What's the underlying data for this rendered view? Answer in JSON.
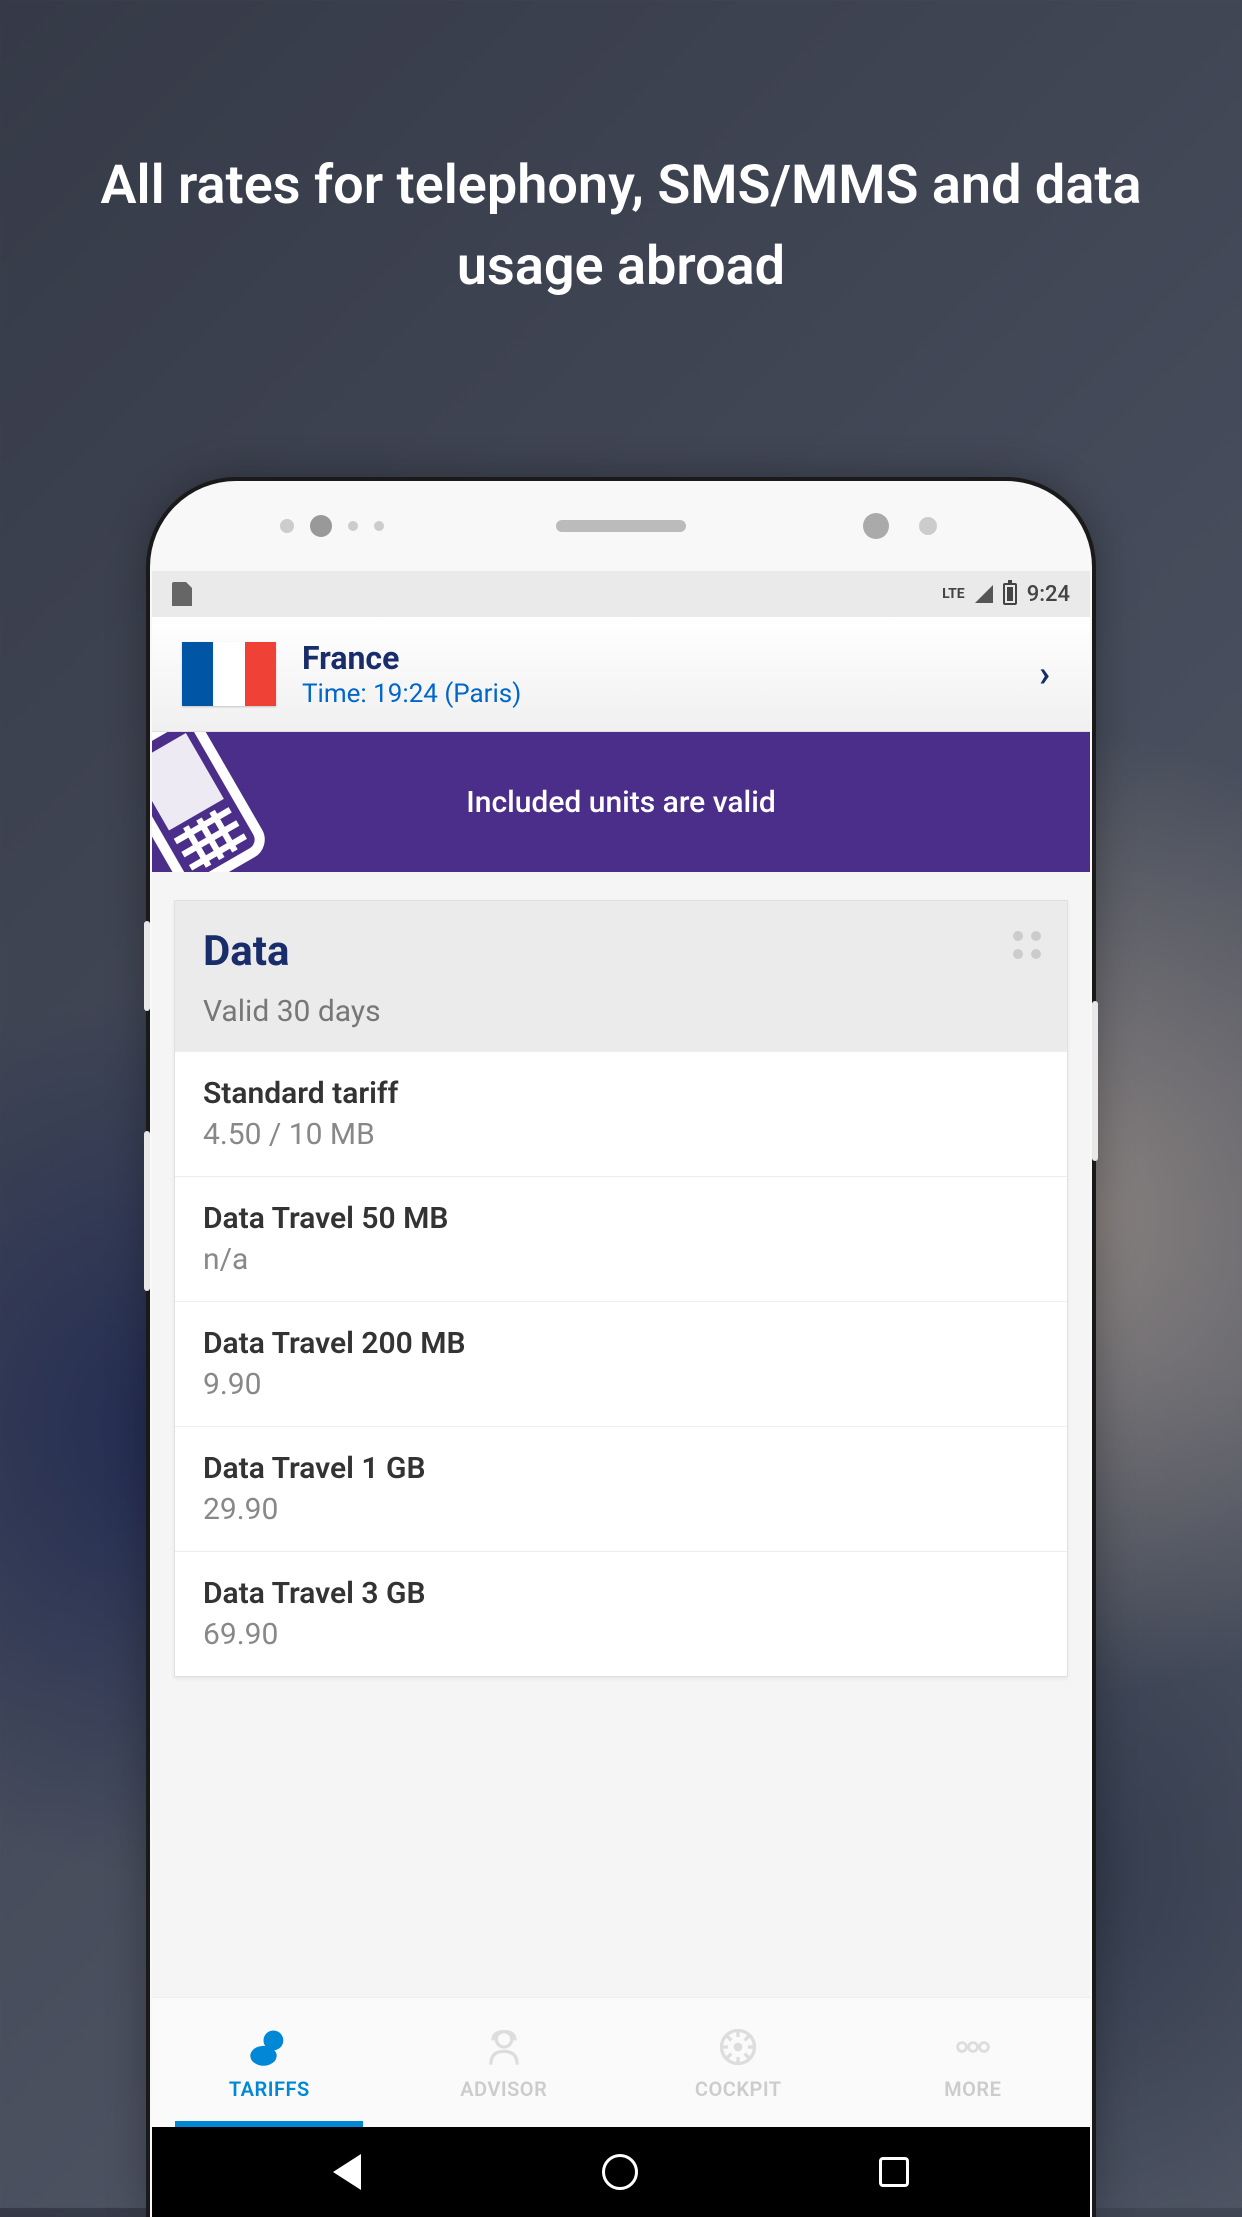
{
  "headline": "All rates for telephony, SMS/MMS and data usage abroad",
  "statusbar": {
    "network": "LTE",
    "time": "9:24"
  },
  "country": {
    "name": "France",
    "time_label": "Time: 19:24 (Paris)"
  },
  "banner": {
    "text": "Included units are valid"
  },
  "card": {
    "title": "Data",
    "subtitle": "Valid 30 days",
    "tariffs": [
      {
        "name": "Standard tariff",
        "price": "4.50 / 10 MB"
      },
      {
        "name": "Data Travel 50 MB",
        "price": "n/a"
      },
      {
        "name": "Data Travel 200 MB",
        "price": "9.90"
      },
      {
        "name": "Data Travel 1 GB",
        "price": "29.90"
      },
      {
        "name": "Data Travel 3 GB",
        "price": "69.90"
      }
    ]
  },
  "nav": {
    "tariffs": "TARIFFS",
    "advisor": "ADVISOR",
    "cockpit": "COCKPIT",
    "more": "MORE"
  }
}
